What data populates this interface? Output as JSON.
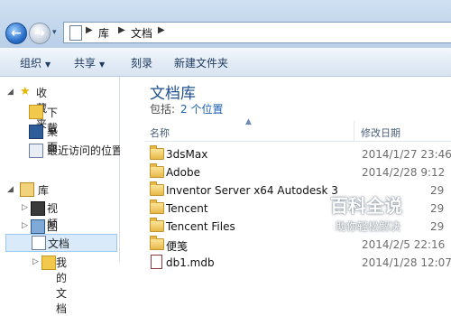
{
  "address": {
    "path": [
      "库",
      "文档"
    ]
  },
  "toolbar": {
    "organize_label": "组织",
    "share_label": "共享",
    "burn_label": "刻录",
    "new_folder_label": "新建文件夹"
  },
  "nav": {
    "favorites_label": "收藏夹",
    "downloads_label": "下载",
    "desktop_label": "桌面",
    "recent_label": "最近访问的位置",
    "libraries_label": "库",
    "videos_label": "视频",
    "pictures_label": "图片",
    "documents_label": "文档",
    "my_documents_label": "我的文档"
  },
  "library": {
    "title": "文档库",
    "includes_label": "包括:",
    "locations_link": "2 个位置"
  },
  "columns": {
    "name": "名称",
    "date_modified": "修改日期"
  },
  "files": [
    {
      "name": "3dsMax",
      "date": "2014/1/27 23:46",
      "type": "folder"
    },
    {
      "name": "Adobe",
      "date": "2014/2/28 9:12",
      "type": "folder"
    },
    {
      "name": "Inventor Server x64 Autodesk 3",
      "date": "29",
      "type": "folder"
    },
    {
      "name": "Tencent",
      "date": "29",
      "type": "folder"
    },
    {
      "name": "Tencent Files",
      "date": "29",
      "type": "folder"
    },
    {
      "name": "便笺",
      "date": "2014/2/5 22:16",
      "type": "folder"
    },
    {
      "name": "db1.mdb",
      "date": "2014/1/28 12:07",
      "type": "file"
    }
  ],
  "watermark": {
    "title": "百科全说",
    "subtitle": "助你轻松解决"
  }
}
